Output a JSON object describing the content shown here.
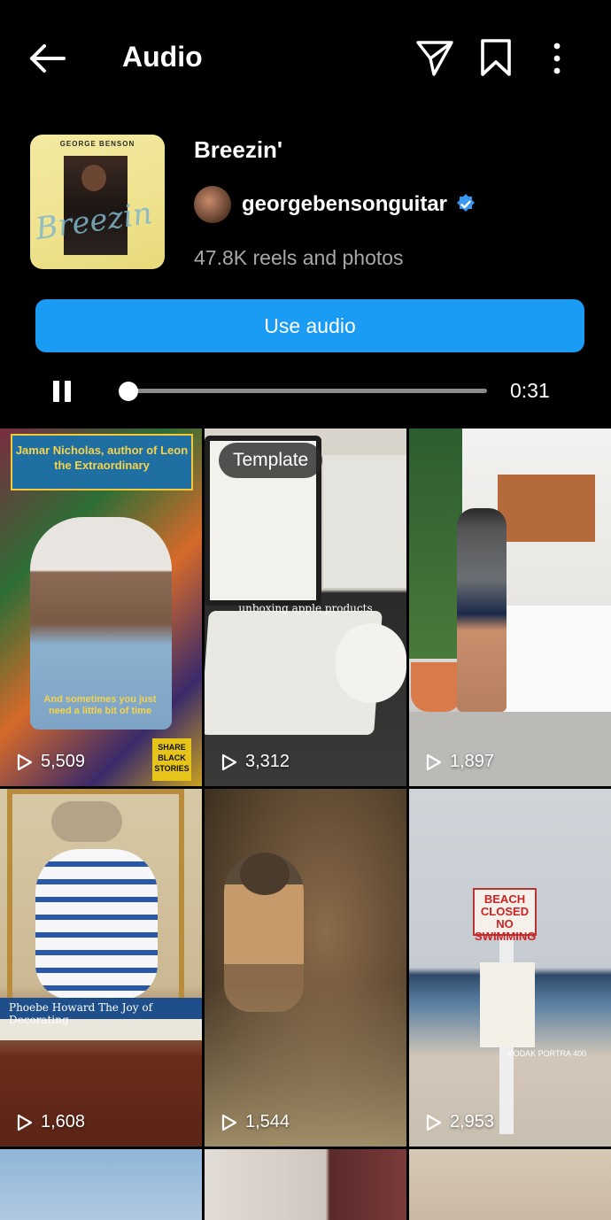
{
  "header": {
    "title": "Audio",
    "back_icon": "arrow-left-icon",
    "share_icon": "send-icon",
    "save_icon": "bookmark-icon",
    "more_icon": "more-vertical-icon"
  },
  "audio": {
    "song_title": "Breezin'",
    "artist": "georgebensonguitar",
    "verified": true,
    "reel_count": "47.8K reels and photos",
    "cover_label": "GEORGE BENSON",
    "cover_script": "Breezin"
  },
  "actions": {
    "use_audio_label": "Use audio"
  },
  "player": {
    "state": "playing",
    "position": 0.0,
    "time": "0:31"
  },
  "colors": {
    "background": "#000000",
    "accent": "#1a9cf5",
    "verified_badge": "#3897f0",
    "muted_text": "#a8a8a8"
  },
  "grid": [
    {
      "views": "5,509",
      "top_text": "Jamar Nicholas, author of Leon the Extraordinary",
      "caption": "And sometimes you just need a little bit of time",
      "badge": "SHARE BLACK STORIES"
    },
    {
      "views": "3,312",
      "pill": "Template",
      "caption": "unboxing apple products"
    },
    {
      "views": "1,897"
    },
    {
      "views": "1,608",
      "book_title": "Phoebe Howard The Joy of Decorating"
    },
    {
      "views": "1,544"
    },
    {
      "views": "2,953",
      "sign_text": "BEACH CLOSED NO SWIMMING",
      "watermark": "KODAK PORTRA 400"
    }
  ]
}
